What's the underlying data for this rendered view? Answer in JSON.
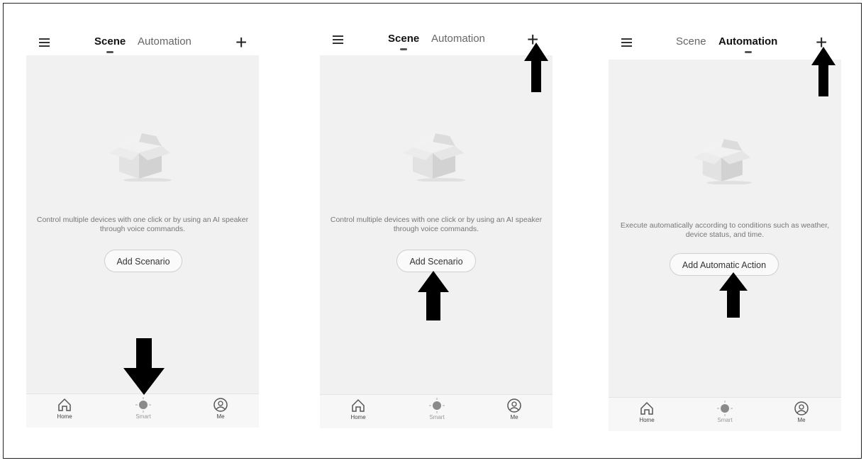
{
  "screens": [
    {
      "header": {
        "scene_label": "Scene",
        "automation_label": "Automation",
        "active_tab": "Scene"
      },
      "description": "Control multiple devices with one click or by using an AI speaker through voice commands.",
      "cta_label": "Add Scenario",
      "tabbar": {
        "home_label": "Home",
        "smart_label": "Smart",
        "me_label": "Me"
      }
    },
    {
      "header": {
        "scene_label": "Scene",
        "automation_label": "Automation",
        "active_tab": "Scene"
      },
      "description": "Control multiple devices with one click or by using an AI speaker through voice commands.",
      "cta_label": "Add Scenario",
      "tabbar": {
        "home_label": "Home",
        "smart_label": "Smart",
        "me_label": "Me"
      }
    },
    {
      "header": {
        "scene_label": "Scene",
        "automation_label": "Automation",
        "active_tab": "Automation"
      },
      "description": "Execute automatically according to conditions such as weather, device status, and time.",
      "cta_label": "Add Automatic Action",
      "tabbar": {
        "home_label": "Home",
        "smart_label": "Smart",
        "me_label": "Me"
      }
    }
  ],
  "icons": {
    "menu": "menu-icon",
    "add": "plus-icon",
    "empty_state": "box-icon",
    "home": "home-icon",
    "smart": "smart-icon",
    "me": "profile-icon",
    "annotation": "arrow-icon"
  },
  "colors": {
    "content_bg": "#f1f1f1",
    "tabbar_bg": "#f7f7f7",
    "arrow": "#000000"
  }
}
